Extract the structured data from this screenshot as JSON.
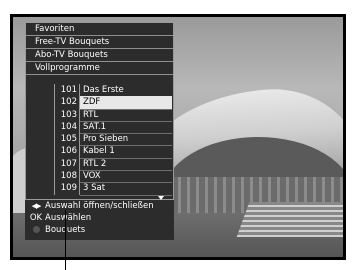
{
  "categories": [
    {
      "label": "Favoriten"
    },
    {
      "label": "Free-TV Bouquets"
    },
    {
      "label": "Abo-TV Bouquets"
    },
    {
      "label": "Vollprogramme"
    }
  ],
  "channels": [
    {
      "number": "101",
      "name": "Das Erste"
    },
    {
      "number": "102",
      "name": "ZDF"
    },
    {
      "number": "103",
      "name": "RTL"
    },
    {
      "number": "104",
      "name": "SAT.1"
    },
    {
      "number": "105",
      "name": "Pro Sieben"
    },
    {
      "number": "106",
      "name": "Kabel 1"
    },
    {
      "number": "107",
      "name": "RTL 2"
    },
    {
      "number": "108",
      "name": "VOX"
    },
    {
      "number": "109",
      "name": "3 Sat"
    }
  ],
  "selected_channel": "102",
  "help": {
    "toggle_key": "◀▶",
    "toggle_text": "Auswahl öffnen/schließen",
    "ok_key": "OK",
    "ok_text": "Auswählen",
    "bouquets_text": "Bouquets"
  },
  "icons": {
    "scroll_down": "triangle-down-icon",
    "left_right": "left-right-arrows-icon",
    "color_button": "gray-button-icon"
  }
}
